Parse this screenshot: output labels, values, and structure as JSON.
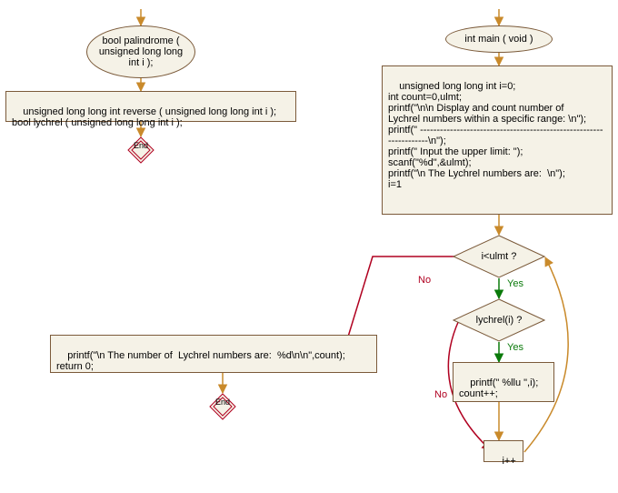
{
  "left": {
    "ellipse": "bool palindrome (\nunsigned long\nlong int i );",
    "rect": "unsigned long long int reverse ( unsigned long long int i );\nbool lychrel ( unsigned long long int i );",
    "end": "End"
  },
  "right": {
    "ellipse": "int main ( void )",
    "init_rect": "unsigned long long int i=0;\nint count=0,ulmt;\nprintf(\"\\n\\n Display and count number of\nLychrel numbers within a specific range: \\n\");\nprintf(\" -------------------------------------------------------------------\\n\");\nprintf(\" Input the upper limit: \");\nscanf(\"%d\",&ulmt);\nprintf(\"\\n The Lychrel numbers are:  \\n\");\ni=1",
    "cond1": "i<ulmt ?",
    "cond2": "lychrel(i) ?",
    "yes": "Yes",
    "no": "No",
    "print_block": "printf(\" %llu \",i);\ncount++;",
    "inc_block": "i++",
    "result_block": "printf(\"\\n The number of  Lychrel numbers are:  %d\\n\\n\",count);\nreturn 0;",
    "end": "End"
  }
}
